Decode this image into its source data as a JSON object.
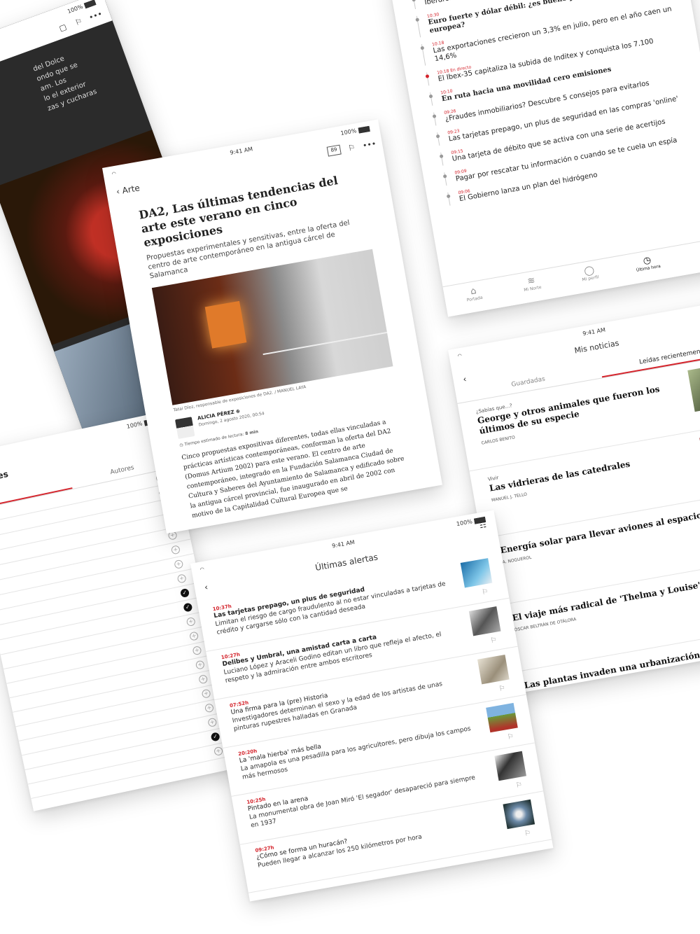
{
  "status": {
    "time": "9:41 AM",
    "battery": "100%"
  },
  "screen_a": {
    "text_lines": [
      "del Dolce",
      "ondo que se",
      "am. Los",
      "lo el exterior",
      "zas y cucharas"
    ]
  },
  "article": {
    "back_label": "Arte",
    "comment_count": "89",
    "title": "DA2, Las últimas tendencias del arte este verano en cinco exposiciones",
    "subtitle": "Propuestas experimentales y sensitivas, entre la oferta del centro de arte contemporáneo en la antigua cárcel de Salamanca",
    "caption": "Tatai Díez, responsable de exposiciones de DA2. / MANUEL LAYA",
    "author_name": "ALICIA PÉREZ",
    "author_date": "Domingo, 2 agosto 2020, 00:54",
    "read_time_label": "Tiempo estimado de lectura:",
    "read_time_value": "8 min",
    "body": "Cinco propuestas expositivas diferentes, todas ellas vinculadas a prácticas artísticas contemporáneas, conforman la oferta del DA2 (Domus Artium 2002) para este verano. El centro de arte contemporáneo, integrado en la Fundación Salamanca Ciudad de Cultura y Saberes del Ayuntamiento de Salamanca y edificado sobre la antigua cárcel provincial, fue inaugurado en abril de 2002 con motivo de la Capitalidad Cultural Europea que se"
  },
  "interests": {
    "title": "tereses",
    "tabs": [
      "",
      "Autores"
    ],
    "rows": [
      false,
      true,
      false,
      false,
      false,
      false,
      false,
      false,
      true,
      true,
      false,
      false,
      false,
      false,
      false,
      false,
      false,
      false,
      true,
      false
    ]
  },
  "last_hour": {
    "items": [
      {
        "time": "10:39",
        "title": "Iberdrola desembarca en proyecto eólico marino",
        "style": "sans"
      },
      {
        "time": "10:30",
        "title": "Euro fuerte y dólar débil: ¿es bueno para la economía europea?",
        "style": "serif"
      },
      {
        "time": "10:18",
        "title": "Las exportaciones crecieron un 3,3% en julio, pero en el año caen un 14,6%",
        "style": "sans"
      },
      {
        "time": "10:18 En directo",
        "title": "El Ibex-35 capitaliza la subida de Inditex y conquista los 7.100",
        "style": "sans",
        "live": true
      },
      {
        "time": "10:10",
        "title": "En ruta hacia una movilidad cero emisiones",
        "style": "serif"
      },
      {
        "time": "09:26",
        "title": "¿Fraudes inmobiliarios? Descubre 5 consejos para evitarlos",
        "style": "sans"
      },
      {
        "time": "09:23",
        "title": "Las tarjetas prepago, un plus de seguridad en las compras 'online'",
        "style": "sans"
      },
      {
        "time": "09:15",
        "title": "Una tarjeta de débito que se activa con una serie de acertijos",
        "style": "sans"
      },
      {
        "time": "09:09",
        "title": "Pagar por rescatar tu información o cuando se te cuela un espía",
        "style": "sans"
      },
      {
        "time": "09:06",
        "title": "El Gobierno lanza un plan del hidrógeno",
        "style": "sans"
      }
    ],
    "tabbar": [
      {
        "label": "Portada",
        "icon": "home-icon",
        "glyph": "⌂"
      },
      {
        "label": "Mi Norte",
        "icon": "layers-icon",
        "glyph": "≋"
      },
      {
        "label": "Mi perfil",
        "icon": "user-icon",
        "glyph": "◯"
      },
      {
        "label": "Última hora",
        "icon": "clock-icon",
        "glyph": "◷",
        "active": true
      },
      {
        "label": "Menú",
        "icon": "menu-icon",
        "glyph": "☰"
      }
    ]
  },
  "alerts": {
    "title": "Últimas alertas",
    "items": [
      {
        "time": "10:37h",
        "headline": "Las tarjetas prepago, un plus de seguridad",
        "bold": true,
        "desc": "Limitan el riesgo de cargo fraudulento al no estar vinculadas a tarjetas de crédito y cargarse sólo con la cantidad deseada",
        "thumb": "th-train"
      },
      {
        "time": "10:27h",
        "headline": "Delibes y Umbral, una amistad carta a carta",
        "bold": true,
        "desc": "Luciano López y Araceli Godino editan un libro que refleja el afecto, el respeto y la admiración entre ambos escritores",
        "thumb": "th-bw1"
      },
      {
        "time": "07:52h",
        "headline": "Una firma para la (pre) Historia",
        "bold": false,
        "desc": "Investigadores determinan el sexo y la edad de los artistas de unas pinturas rupestres halladas en Granada",
        "thumb": "th-bw2"
      },
      {
        "time": "20:20h",
        "headline": "La 'mala hierba' más bella",
        "bold": false,
        "desc": "La amapola es una pesadilla para los agricultores, pero dibuja los campos más hermosos",
        "thumb": "th-field"
      },
      {
        "time": "10:25h",
        "headline": "Pintado en la arena",
        "bold": false,
        "desc": "La monumental obra de Joan Miró 'El segador' desapareció para siempre en 1937",
        "thumb": "th-bw3"
      },
      {
        "time": "09:27h",
        "headline": "¿Cómo se forma un huracán?",
        "bold": false,
        "desc": "Pueden llegar a alcanzar los 250 kilómetros por hora",
        "thumb": "th-storm"
      }
    ]
  },
  "my_news": {
    "title": "Mis noticias",
    "tabs": [
      "Guardadas",
      "Leídas recientemente"
    ],
    "cards": [
      {
        "kicker": "¿Sabías que...?",
        "headline": "George y otros animales que fueron los últimos de su especie",
        "author": "CARLOS BENITO",
        "thumb": "th-turtle"
      },
      {
        "kicker": "Vivir",
        "headline": "Las vidrieras de las catedrales",
        "author": "MANUEL J. TELLO",
        "thumb": "th-glass"
      },
      {
        "kicker": "",
        "headline": "Energía solar para llevar aviones al espacio",
        "author": "A. NOGUEROL",
        "thumb": "th-plane"
      },
      {
        "kicker": "",
        "headline": "El viaje más radical de 'Thelma y Louise'",
        "author": "ÓSCAR BELTRÁN DE OTÁLORA",
        "thumb": "th-car"
      },
      {
        "kicker": "",
        "headline": "Las plantas invaden una urbanización en China y 'expulsan' a los vecinos",
        "author": "",
        "thumb": ""
      }
    ]
  }
}
